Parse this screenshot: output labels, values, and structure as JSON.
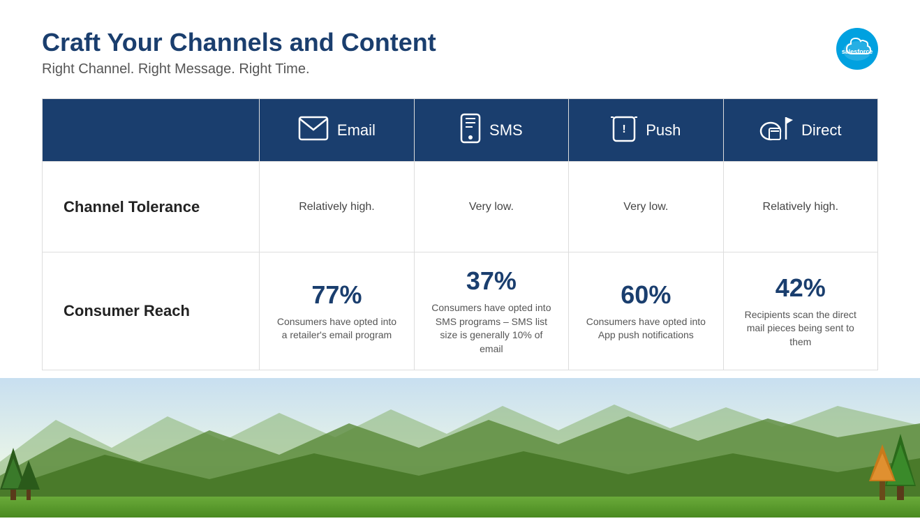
{
  "header": {
    "main_title": "Craft Your Channels and Content",
    "subtitle": "Right Channel. Right Message. Right Time.",
    "logo_text": "salesforce"
  },
  "table": {
    "columns": [
      {
        "id": "label",
        "label": ""
      },
      {
        "id": "email",
        "label": "Email",
        "icon": "email-icon"
      },
      {
        "id": "sms",
        "label": "SMS",
        "icon": "sms-icon"
      },
      {
        "id": "push",
        "label": "Push",
        "icon": "push-icon"
      },
      {
        "id": "direct",
        "label": "Direct",
        "icon": "direct-icon"
      }
    ],
    "rows": [
      {
        "id": "channel-tolerance",
        "row_label": "Channel Tolerance",
        "email_value": "Relatively high.",
        "sms_value": "Very low.",
        "push_value": "Very low.",
        "direct_value": "Relatively high."
      },
      {
        "id": "consumer-reach",
        "row_label": "Consumer Reach",
        "email_percent": "77%",
        "email_desc": "Consumers have opted into a retailer's email program",
        "sms_percent": "37%",
        "sms_desc": "Consumers have opted into SMS programs – SMS list size is generally 10% of email",
        "push_percent": "60%",
        "push_desc": "Consumers have opted into App push notifications",
        "direct_percent": "42%",
        "direct_desc": "Recipients scan the direct mail pieces being sent to them"
      }
    ]
  }
}
